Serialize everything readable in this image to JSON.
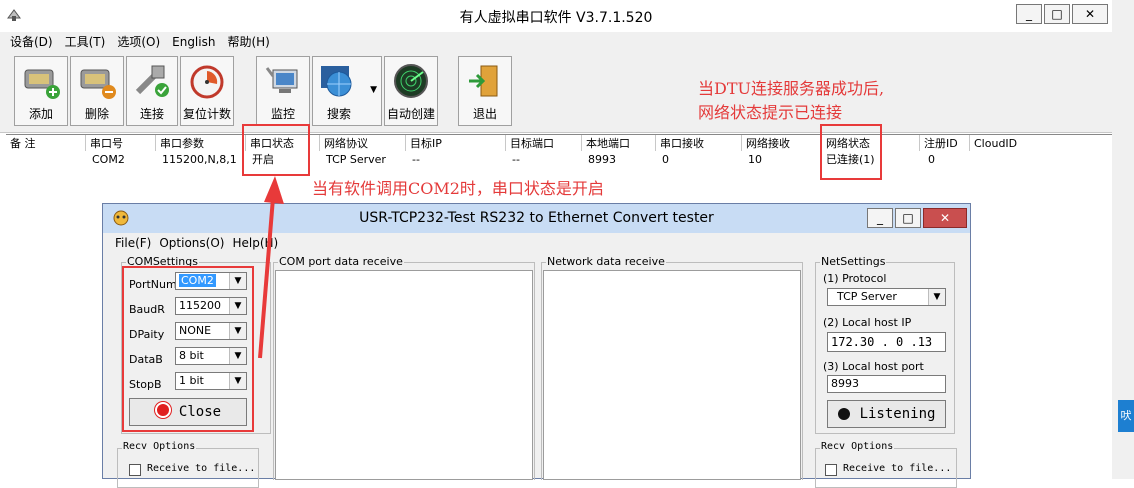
{
  "main_window": {
    "title": "有人虚拟串口软件 V3.7.1.520",
    "controls": {
      "minimize": "_",
      "maximize": "□",
      "close": "✕"
    },
    "menu": [
      "设备(D)",
      "工具(T)",
      "选项(O)",
      "English",
      "帮助(H)"
    ],
    "toolbar": {
      "add": "添加",
      "delete": "删除",
      "connect": "连接",
      "reset_count": "复位计数",
      "monitor": "监控",
      "search": "搜索",
      "auto_create": "自动创建",
      "exit": "退出"
    },
    "grid": {
      "columns": [
        "备 注",
        "串口号",
        "串口参数",
        "串口状态",
        "网络协议",
        "目标IP",
        "目标端口",
        "本地端口",
        "串口接收",
        "网络接收",
        "网络状态",
        "注册ID",
        "CloudID"
      ],
      "rows": [
        [
          "",
          "COM2",
          "115200,N,8,1",
          "开启",
          "TCP Server",
          "--",
          "--",
          "8993",
          "0",
          "10",
          "已连接(1)",
          "0",
          ""
        ]
      ]
    }
  },
  "annotations": {
    "dtu_line1": "当DTU连接服务器成功后,",
    "dtu_line2": "网络状态提示已连接",
    "com2_note": "当有软件调用COM2时，串口状态是开启"
  },
  "child_window": {
    "title": "USR-TCP232-Test  RS232 to Ethernet Convert tester",
    "menu": [
      "File(F)",
      "Options(O)",
      "Help(H)"
    ],
    "com_settings": {
      "group_label": "COMSettings",
      "port_label": "PortNum",
      "port_value": "COM2",
      "baud_label": "BaudR",
      "baud_value": "115200",
      "parity_label": "DPaity",
      "parity_value": "NONE",
      "data_label": "DataB",
      "data_value": "8 bit",
      "stop_label": "StopB",
      "stop_value": "1 bit",
      "close_button": "Close"
    },
    "com_receive_label": "COM port data receive",
    "net_receive_label": "Network data receive",
    "net_settings": {
      "group_label": "NetSettings",
      "protocol_label": "(1) Protocol",
      "protocol_value": "TCP Server",
      "host_ip_label": "(2) Local host IP",
      "host_ip_value": "172.30 . 0 .13",
      "host_port_label": "(3) Local host port",
      "host_port_value": "8993",
      "listening_button": "Listening"
    },
    "recv_options_left": {
      "label": "Recv Options",
      "receive_to_file": "Receive to file..."
    },
    "recv_options_right": {
      "label": "Recv Options",
      "receive_to_file": "Receive to file..."
    }
  },
  "side_tab_text": "吠"
}
